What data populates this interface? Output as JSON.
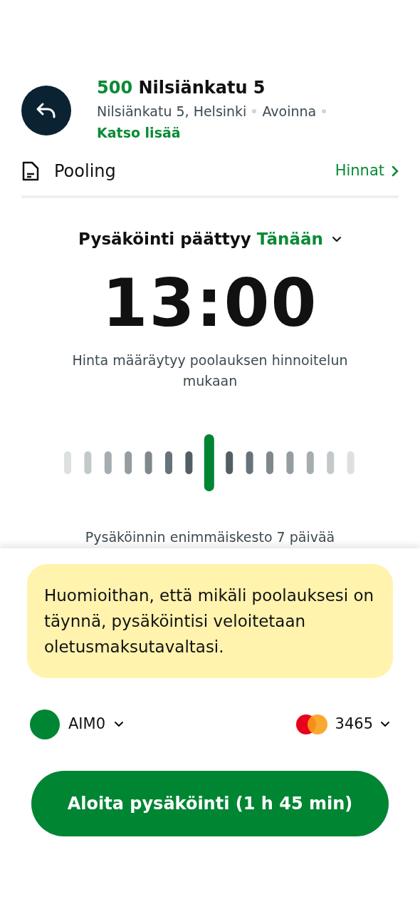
{
  "header": {
    "code": "500",
    "name": "Nilsiänkatu 5",
    "address": "Nilsiänkatu 5, Helsinki",
    "status": "Avoinna",
    "more_link": "Katso lisää"
  },
  "zone": {
    "label": "Pooling",
    "prices_link": "Hinnat"
  },
  "end": {
    "label": "Pysäköinti päättyy",
    "day": "Tänään",
    "time": "13:00",
    "note": "Hinta määräytyy poolauksen hinnoitelun mukaan",
    "max_note": "Pysäköinnin enimmäiskesto 7 päivää"
  },
  "notice": "Huomioithan, että mikäli poolauksesi on täynnä, pysäköintisi veloitetaan oletusmaksutavaltasi.",
  "account": {
    "label": "AIM0",
    "color": "#008533"
  },
  "payment": {
    "card": "3465"
  },
  "start_button": "Aloita pysäköinti (1 h 45 min)"
}
